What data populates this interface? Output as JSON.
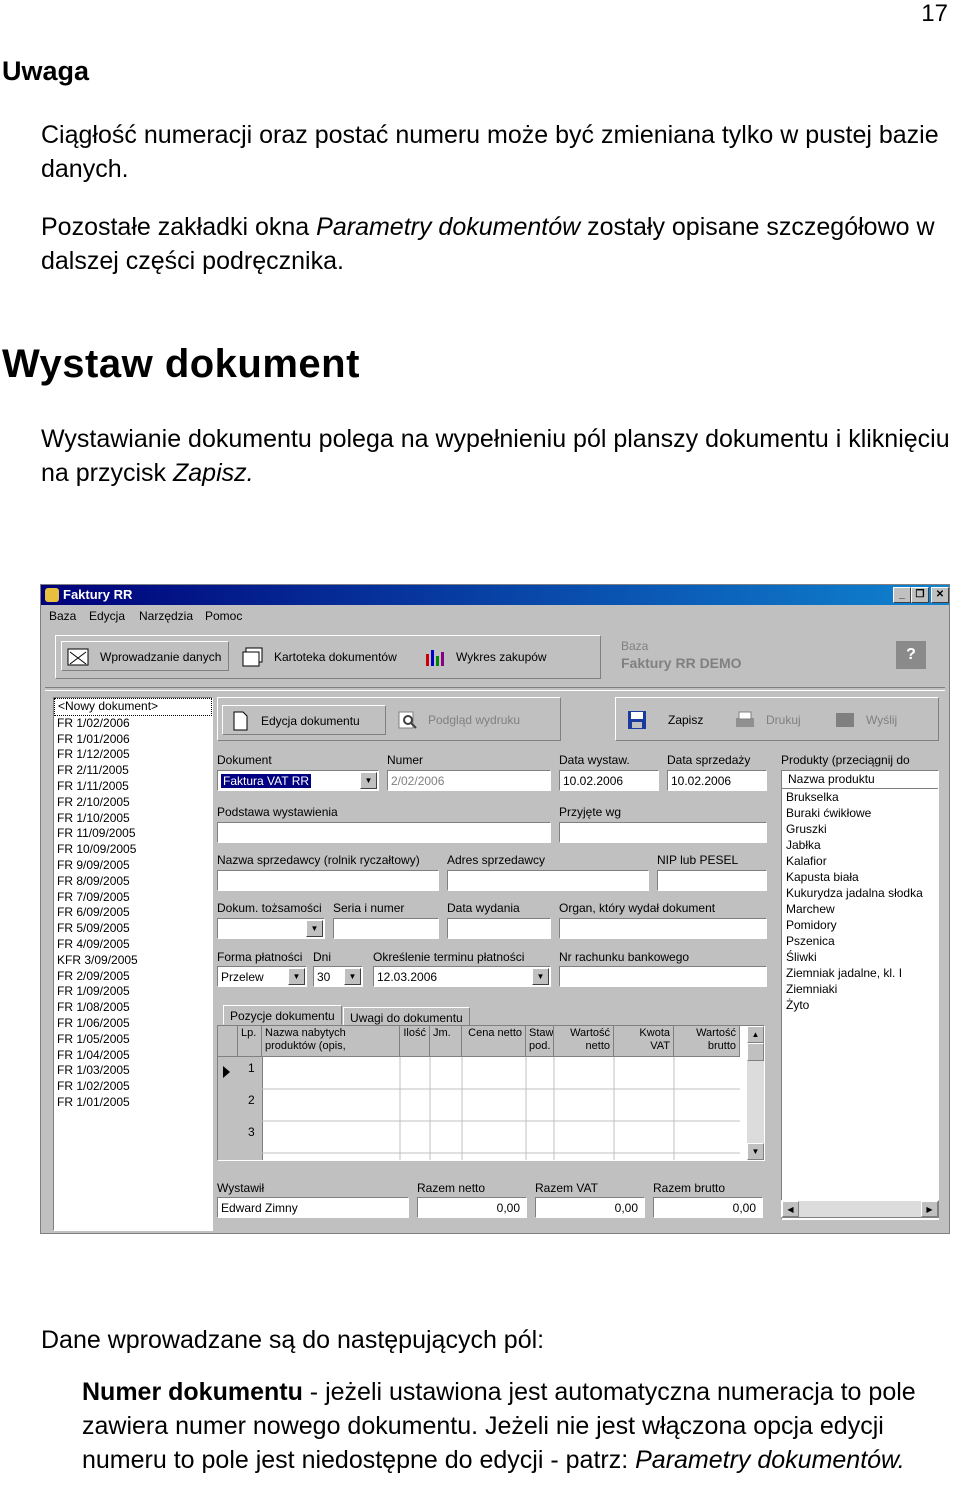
{
  "page_number": "17",
  "heading_uwaga": "Uwaga",
  "para1": "Ciągłość numeracji oraz postać numeru może być zmieniana tylko w pustej bazie danych.",
  "para2_a": "Pozostałe zakładki okna ",
  "para2_em": "Parametry dokumentów",
  "para2_b": " zostały opisane szczegółowo w dalszej części podręcznika.",
  "heading_wystaw": "Wystaw dokument",
  "para3_a": "Wystawianie dokumentu polega na wypełnieniu pól planszy dokumentu i kliknięciu na przycisk ",
  "para3_em": "Zapisz.",
  "para4": "Dane wprowadzane są do następujących pól:",
  "para5_bold": "Numer dokumentu",
  "para5_a": " - jeżeli ustawiona jest automatyczna numeracja to pole zawiera numer nowego dokumentu. Jeżeli nie jest włączona opcja edycji numeru to pole jest niedostępne do edycji - patrz: ",
  "para5_em": "Parametry dokumentów.",
  "app": {
    "title": "Faktury RR",
    "menu": [
      "Baza",
      "Edycja",
      "Narzędzia",
      "Pomoc"
    ],
    "toolbar": [
      "Wprowadzanie danych",
      "Kartoteka dokumentów",
      "Wykres zakupów"
    ],
    "baza_label": "Baza",
    "baza_value": "Faktury RR DEMO",
    "help": "?",
    "doc_list": [
      "<Nowy dokument>",
      "FR  1/02/2006",
      "FR  1/01/2006",
      "FR  1/12/2005",
      "FR  2/11/2005",
      "FR  1/11/2005",
      "FR  2/10/2005",
      "FR  1/10/2005",
      "FR  11/09/2005",
      "FR  10/09/2005",
      "FR  9/09/2005",
      "FR  8/09/2005",
      "FR  7/09/2005",
      "FR  6/09/2005",
      "FR  5/09/2005",
      "FR  4/09/2005",
      "KFR  3/09/2005",
      "FR  2/09/2005",
      "FR  1/09/2005",
      "FR  1/08/2005",
      "FR  1/06/2005",
      "FR  1/05/2005",
      "FR  1/04/2005",
      "FR  1/03/2005",
      "FR  1/02/2005",
      "FR  1/01/2005"
    ],
    "btn_edycja": "Edycja dokumentu",
    "btn_podglad": "Podgląd wydruku",
    "btn_zapisz": "Zapisz",
    "btn_drukuj": "Drukuj",
    "btn_wyslij": "Wyślij",
    "labels": {
      "dokument": "Dokument",
      "numer": "Numer",
      "data_wystaw": "Data wystaw.",
      "data_sprzedazy": "Data sprzedaży",
      "produkty": "Produkty (przeciągnij do",
      "podstawa": "Podstawa wystawienia",
      "przyjete": "Przyjęte wg",
      "nazwa_sprzedawcy": "Nazwa sprzedawcy (rolnik ryczałtowy)",
      "adres_sprzedawcy": "Adres sprzedawcy",
      "nip": "NIP lub PESEL",
      "dokum_tozsamosci": "Dokum. tożsamości",
      "seria": "Seria i numer",
      "data_wydania": "Data wydania",
      "organ": "Organ, który wydał dokument",
      "forma_platnosci": "Forma płatności",
      "dni": "Dni",
      "okreslenie": "Określenie terminu płatności",
      "nr_rachunku": "Nr rachunku bankowego",
      "wystawil": "Wystawił",
      "razem_netto": "Razem netto",
      "razem_vat": "Razem VAT",
      "razem_brutto": "Razem brutto"
    },
    "values": {
      "dokument": "Faktura VAT RR",
      "numer": "2/02/2006",
      "data_wystaw": "10.02.2006",
      "data_sprzedazy": "10.02.2006",
      "forma_platnosci": "Przelew",
      "dni": "30",
      "termin": "12.03.2006",
      "wystawil": "Edward Zimny",
      "razem_netto": "0,00",
      "razem_vat": "0,00",
      "razem_brutto": "0,00"
    },
    "tabs": [
      "Pozycje dokumentu",
      "Uwagi do dokumentu"
    ],
    "grid_headers": [
      "Lp.",
      "Nazwa nabytych produktów (opis,",
      "Ilość",
      "Jm.",
      "Cena netto",
      "Staw. pod.",
      "Wartość netto",
      "Kwota VAT",
      "Wartość brutto"
    ],
    "grid_rows": [
      "1",
      "2",
      "3"
    ],
    "products_header": "Nazwa produktu",
    "products": [
      "Brukselka",
      "Buraki ćwikłowe",
      "Gruszki",
      "Jabłka",
      "Kalafior",
      "Kapusta biała",
      "Kukurydza jadalna słodka",
      "Marchew",
      "Pomidory",
      "Pszenica",
      "Śliwki",
      "Ziemniak jadalne, kl. I",
      "Ziemniaki",
      "Żyto"
    ]
  }
}
